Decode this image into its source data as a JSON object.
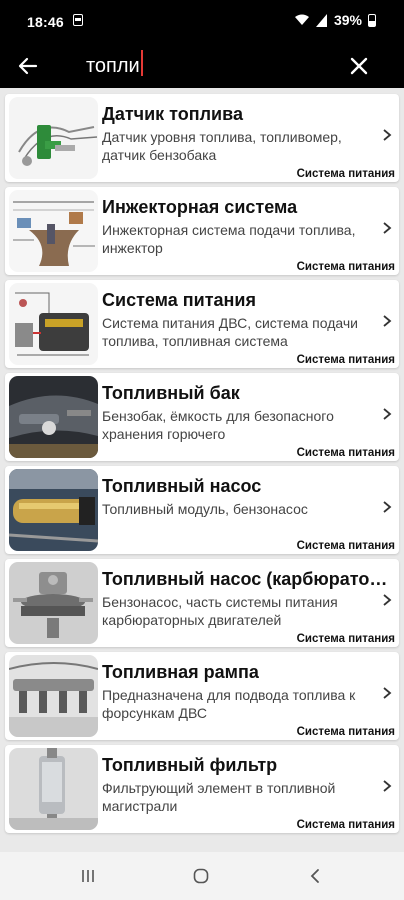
{
  "status_bar": {
    "time": "18:46",
    "battery": "39%"
  },
  "search": {
    "query": "топли"
  },
  "results": [
    {
      "title": "Датчик топлива",
      "description": "Датчик уровня топлива, топливомер, датчик бензобака",
      "category": "Система питания",
      "image": "fuel-level-sensor-image"
    },
    {
      "title": "Инжекторная система",
      "description": "Инжекторная система подачи топлива, инжектор",
      "category": "Система питания",
      "image": "injector-system-diagram-image"
    },
    {
      "title": "Система питания",
      "description": "Система питания ДВС, система подачи топлива, топливная система",
      "category": "Система питания",
      "image": "fuel-system-diagram-image"
    },
    {
      "title": "Топливный бак",
      "description": "Бензобак, ёмкость для безопасного хранения горючего",
      "category": "Система питания",
      "image": "fuel-tank-photo"
    },
    {
      "title": "Топливный насос",
      "description": "Топливный модуль, бензонасос",
      "category": "Система питания",
      "image": "fuel-pump-photo"
    },
    {
      "title": "Топливный насос (карбюраторный)",
      "description": "Бензонасос, часть системы питания карбюраторных двигателей",
      "category": "Система питания",
      "image": "carburetor-fuel-pump-photo"
    },
    {
      "title": "Топливная рампа",
      "description": "Предназначена для подвода топлива к форсункам ДВС",
      "category": "Система питания",
      "image": "fuel-rail-photo"
    },
    {
      "title": "Топливный фильтр",
      "description": "Фильтрующий элемент в топливной магистрали",
      "category": "Система питания",
      "image": "fuel-filter-photo"
    }
  ]
}
